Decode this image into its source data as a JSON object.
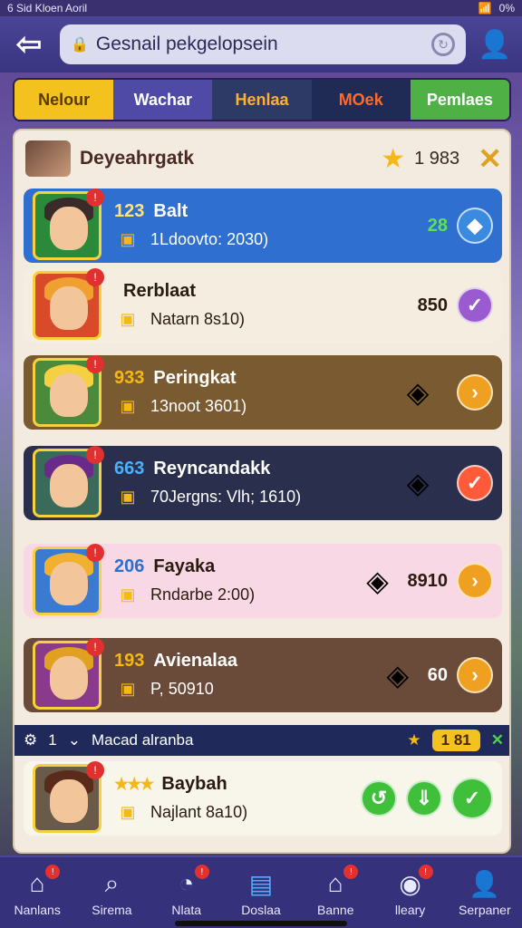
{
  "status": {
    "left": "6 Sid Kloen Aoril",
    "battery": "0%"
  },
  "search": {
    "value": "Gesnail pekgelopsein"
  },
  "tabs": [
    "Nelour",
    "Wachar",
    "Henlaa",
    "MOek",
    "Pemlaes"
  ],
  "header": {
    "title": "Deyeahrgatk",
    "score": "1 983"
  },
  "cards": [
    {
      "rank": "123",
      "name": "Balt",
      "sub": "1Ldoovto: 2030)",
      "value": "28",
      "action": "diamond",
      "bg": "#2e6fcf",
      "fg": "#ffffff",
      "rankColor": "#ffe27a"
    },
    {
      "rank": "",
      "name": "Rerblaat",
      "sub": "Natarn 8s10)",
      "value": "850",
      "action": "check",
      "bg": "#f5ede0",
      "fg": "#2a1a10",
      "rankColor": "#f5b814"
    },
    {
      "rank": "933",
      "name": "Peringkat",
      "sub": "13noot 3601)",
      "value": "",
      "action": "arrow",
      "bg": "#7a5a30",
      "fg": "#ffffff",
      "rankColor": "#f5b814"
    },
    {
      "rank": "663",
      "name": "Reyncandakk",
      "sub": "70Jergns: Vlh; 1610)",
      "value": "",
      "action": "check",
      "bg": "#2a2f4e",
      "fg": "#ffffff",
      "rankColor": "#4ab0ff"
    },
    {
      "rank": "206",
      "name": "Fayaka",
      "sub": "Rndarbe 2:00)",
      "value": "8910",
      "action": "arrow",
      "bg": "#f8d8e4",
      "fg": "#2a1a10",
      "rankColor": "#2b6fd0"
    },
    {
      "rank": "193",
      "name": "Avienalaa",
      "sub": "P, 50910",
      "value": "60",
      "action": "arrow",
      "bg": "#6a4a38",
      "fg": "#ffffff",
      "rankColor": "#f5b814"
    }
  ],
  "subbar": {
    "num": "1",
    "label": "Macad alranba",
    "pill": "1 81"
  },
  "lastcard": {
    "name": "Baybah",
    "sub": "Najlant 8a10)"
  },
  "nav": [
    "Nanlans",
    "Sirema",
    "Nlata",
    "Doslaa",
    "Banne",
    "lleary",
    "Serpaner"
  ]
}
